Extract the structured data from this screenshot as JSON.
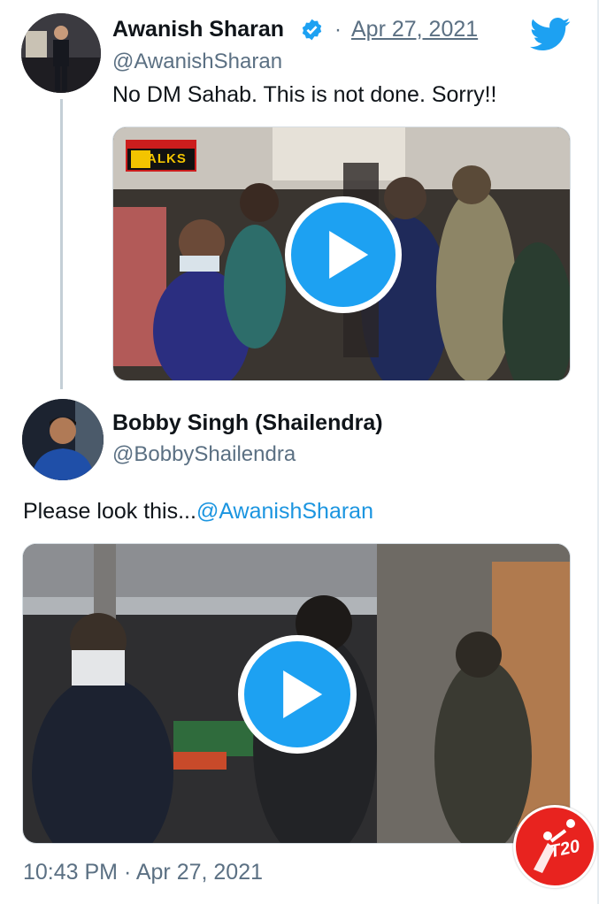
{
  "quoted_tweet": {
    "author_name": "Awanish Sharan",
    "author_handle": "@AwanishSharan",
    "separator": "·",
    "date": "Apr 27, 2021",
    "text": "No DM Sahab. This is not done. Sorry!!",
    "video_logo_text": "ALKS"
  },
  "main_tweet": {
    "author_name": "Bobby Singh (Shailendra)",
    "author_handle": "@BobbyShailendra",
    "text": "Please look this...",
    "mention": "@AwanishSharan",
    "timestamp": "10:43 PM · Apr 27, 2021"
  },
  "watermark": {
    "label": "T20"
  },
  "colors": {
    "accent": "#1da1f2",
    "link": "#1b95e0",
    "secondary_text": "#5b7083",
    "badge": "#e8231f"
  },
  "icons": {
    "verified": "verified-badge-icon",
    "brand": "twitter-bird-icon",
    "play": "play-icon"
  }
}
